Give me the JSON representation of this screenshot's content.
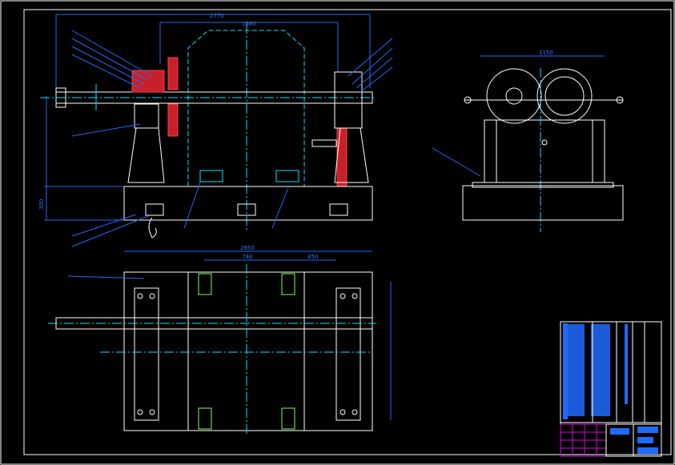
{
  "drawing": {
    "background": "#000000",
    "colors": {
      "outline": "#ffffff",
      "centerline": "#00e5ff",
      "dimension": "#1e6bff",
      "section": "#c8202a",
      "title_grid": "#e000e0"
    },
    "dimensions": {
      "front_overall_length": "2770",
      "front_motor_width": "1680",
      "front_base_height": "300",
      "side_width": "1150",
      "plan_overall_length": "2850",
      "plan_span_left": "740",
      "plan_span_right": "450"
    }
  }
}
